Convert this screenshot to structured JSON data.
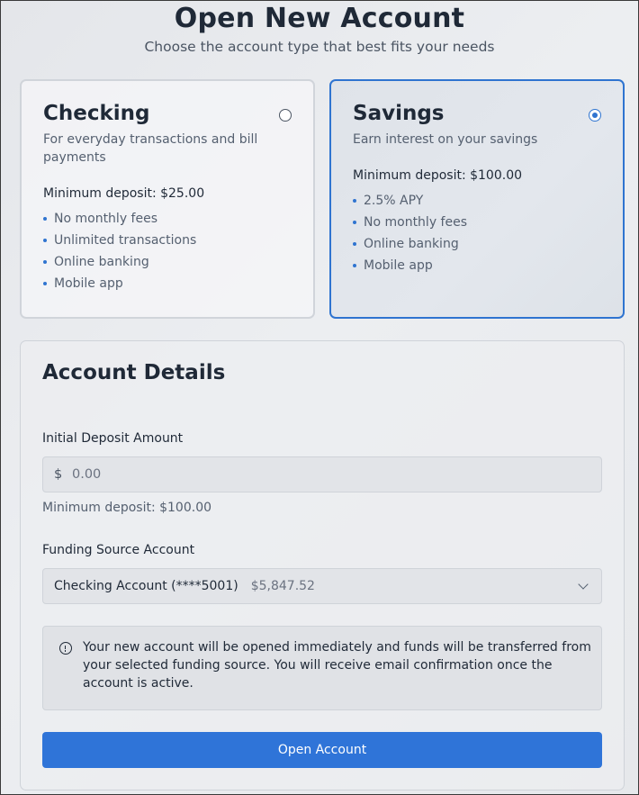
{
  "header": {
    "title": "Open New Account",
    "subtitle": "Choose the account type that best fits your needs"
  },
  "account_types": [
    {
      "name": "Checking",
      "description": "For everyday transactions and bill payments",
      "minimum_deposit": "Minimum deposit: $25.00",
      "features": [
        "No monthly fees",
        "Unlimited transactions",
        "Online banking",
        "Mobile app"
      ],
      "selected": false
    },
    {
      "name": "Savings",
      "description": "Earn interest on your savings",
      "minimum_deposit": "Minimum deposit: $100.00",
      "features": [
        "2.5% APY",
        "No monthly fees",
        "Online banking",
        "Mobile app"
      ],
      "selected": true
    }
  ],
  "details": {
    "title": "Account Details",
    "deposit_label": "Initial Deposit Amount",
    "currency_symbol": "$",
    "deposit_placeholder": "0.00",
    "deposit_helper": "Minimum deposit: $100.00",
    "funding_label": "Funding Source Account",
    "funding_selected": "Checking Account (****5001)",
    "funding_balance": "$5,847.52",
    "notice": "Your new account will be opened immediately and funds will be transferred from your selected funding source. You will receive email confirmation once the account is active.",
    "submit_label": "Open Account"
  },
  "colors": {
    "accent": "#2f74d8",
    "selected_border": "#2f74d0"
  },
  "icons": {
    "notice": "info-circle-icon",
    "select": "chevron-down-icon"
  }
}
